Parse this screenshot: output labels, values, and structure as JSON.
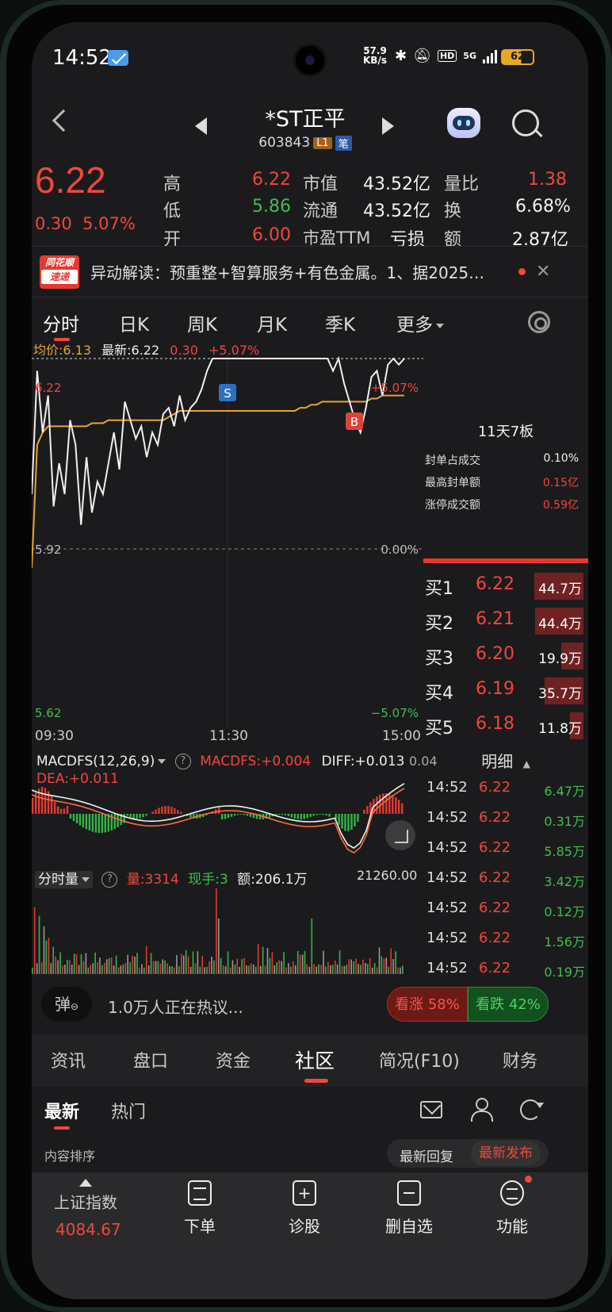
{
  "status_bar": {
    "time": "14:52",
    "net_speed_value": "57.9",
    "net_speed_unit": "KB/s",
    "hd": "HD",
    "network": "5G",
    "battery": "62"
  },
  "header": {
    "stock_name": "*ST正平",
    "stock_code": "603843",
    "tag_level": "L1",
    "tag_note": "笔"
  },
  "quote": {
    "price": "6.22",
    "change_abs": "0.30",
    "change_pct": "5.07%",
    "high_label": "高",
    "high": "6.22",
    "low_label": "低",
    "low": "5.86",
    "open_label": "开",
    "open": "6.00",
    "mktcap_label": "市值",
    "mktcap": "43.52亿",
    "float_label": "流通",
    "float": "43.52亿",
    "pe_label": "市盈TTM",
    "pe": "亏损",
    "volratio_label": "量比",
    "volratio": "1.38",
    "turnover_label": "换",
    "turnover": "6.68%",
    "amount_label": "额",
    "amount": "2.87亿"
  },
  "news": {
    "badge_top": "同花顺",
    "badge_bottom": "速递",
    "text": "异动解读：预重整+智算服务+有色金属。1、据2025…"
  },
  "chart_tabs": [
    "分时",
    "日K",
    "周K",
    "月K",
    "季K",
    "更多"
  ],
  "info_line": {
    "avg_label": "均价:6.13",
    "last_label": "最新:6.22",
    "chg": "0.30",
    "pct": "+5.07%"
  },
  "chart": {
    "y_top": "6.22",
    "y_mid": "5.92",
    "y_bottom": "5.62",
    "pct_top": "+5.07%",
    "pct_mid": "0.00%",
    "pct_bottom": "−5.07%",
    "t_start": "09:30",
    "t_mid": "11:30",
    "t_end": "15:00",
    "sell_marker": "S",
    "buy_marker": "B",
    "colors": {
      "price_line": "#f0f0f0",
      "avg_line": "#e8a33a",
      "limit": "#ffffff"
    }
  },
  "board": {
    "title": "11天7板",
    "stats": [
      {
        "label": "封单占成交",
        "value": "0.10%"
      },
      {
        "label": "最高封单额",
        "value": "0.15亿"
      },
      {
        "label": "涨停成交额",
        "value": "0.59亿"
      }
    ]
  },
  "order_book": [
    {
      "level": "买1",
      "price": "6.22",
      "volume": "44.7万",
      "fill": 0.97
    },
    {
      "level": "买2",
      "price": "6.21",
      "volume": "44.4万",
      "fill": 0.96
    },
    {
      "level": "买3",
      "price": "6.20",
      "volume": "19.9万",
      "fill": 0.43
    },
    {
      "level": "买4",
      "price": "6.19",
      "volume": "35.7万",
      "fill": 0.77
    },
    {
      "level": "买5",
      "price": "6.18",
      "volume": "11.8万",
      "fill": 0.26
    }
  ],
  "macd": {
    "name": "MACDFS(12,26,9)",
    "value": "MACDFS:+0.004",
    "diff": "DIFF:+0.013",
    "dea": "DEA:+0.011",
    "scale": "0.04"
  },
  "detail": {
    "title": "明细",
    "rows": [
      {
        "time": "14:52",
        "price": "6.22",
        "vol": "6.47万"
      },
      {
        "time": "14:52",
        "price": "6.22",
        "vol": "0.31万"
      },
      {
        "time": "14:52",
        "price": "6.22",
        "vol": "5.85万"
      },
      {
        "time": "14:52",
        "price": "6.22",
        "vol": "3.42万"
      },
      {
        "time": "14:52",
        "price": "6.22",
        "vol": "0.12万"
      },
      {
        "time": "14:52",
        "price": "6.22",
        "vol": "1.56万"
      },
      {
        "time": "14:52",
        "price": "6.22",
        "vol": "0.19万"
      }
    ]
  },
  "volume": {
    "name": "分时量",
    "vol": "量:3314",
    "hand": "现手:3",
    "amount": "额:206.1万",
    "max": "21260.00"
  },
  "hot": {
    "danmu": "弹",
    "text": "1.0万人正在热议...",
    "up": "看涨 58%",
    "down": "看跌 42%"
  },
  "section_tabs": [
    "资讯",
    "盘口",
    "资金",
    "社区",
    "简况(F10)",
    "财务"
  ],
  "sub_tabs": [
    "最新",
    "热门"
  ],
  "sort": {
    "label": "内容排序",
    "opt1": "最新回复",
    "opt2": "最新发布"
  },
  "bottom_nav": {
    "index_name": "上证指数",
    "index_value": "4084.67",
    "items": [
      "下单",
      "诊股",
      "删自选",
      "功能"
    ]
  }
}
